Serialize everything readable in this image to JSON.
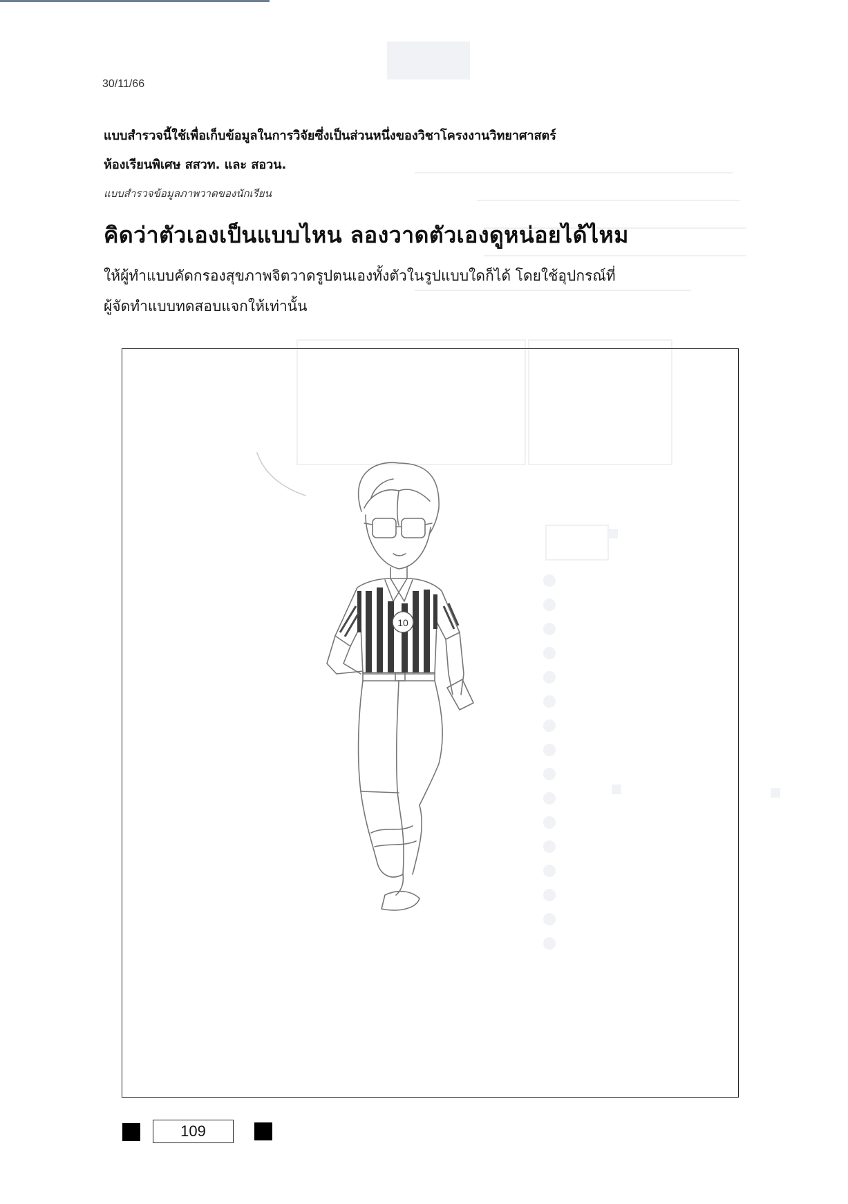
{
  "document": {
    "date": "30/11/66",
    "intro_line1": "แบบสำรวจนี้ใช้เพื่อเก็บข้อมูลในการวิจัยซึ่งเป็นส่วนหนึ่งของวิชาโครงงานวิทยาศาสตร์",
    "intro_line2": "ห้องเรียนพิเศษ สสวท. และ สอวน.",
    "subtitle": "แบบสำรวจข้อมูลภาพวาดของนักเรียน",
    "title": "คิดว่าตัวเองเป็นแบบไหน ลองวาดตัวเองดูหน่อยได้ไหม",
    "instruction_line1": "ให้ผู้ทำแบบคัดกรองสุขภาพจิตวาดรูปตนเองทั้งตัวในรูปแบบใดก็ได้ โดยใช้อุปกรณ์ที่",
    "instruction_line2": "ผู้จัดทำแบบทดสอบแจกให้เท่านั้น",
    "jersey_number": "10",
    "page_id": "109"
  }
}
